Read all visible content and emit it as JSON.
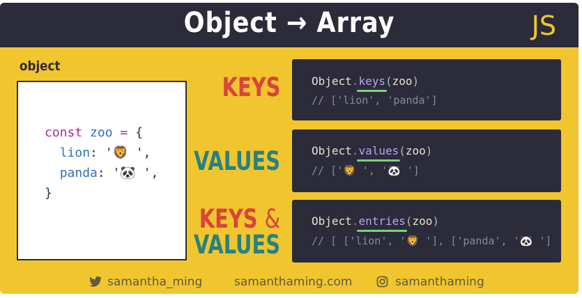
{
  "header": {
    "title": "Object → Array",
    "badge": "JS"
  },
  "object_panel": {
    "label": "object",
    "code": {
      "kw": "const",
      "name": "zoo",
      "op": "=",
      "open": "{",
      "key1": "lion",
      "val1": "'🦁 ',",
      "key2": "panda",
      "val2": "'🐼 ',",
      "close": "}"
    }
  },
  "sections": [
    {
      "label": "KEYS",
      "object": "Object",
      "method": "keys",
      "arg": "zoo",
      "result": "// ['lion', 'panda']"
    },
    {
      "label": "VALUES",
      "object": "Object",
      "method": "values",
      "arg": "zoo",
      "result": "// ['🦁 ', '🐼 ']"
    },
    {
      "label_a": "KEYS",
      "label_amp": "&",
      "label_b": "VALUES",
      "object": "Object",
      "method": "entries",
      "arg": "zoo",
      "result": "// [ ['lion', '🦁 '], ['panda', '🐼 ']"
    }
  ],
  "footer": {
    "twitter": "samantha_ming",
    "website": "samanthaming.com",
    "instagram": "samanthaming"
  },
  "colors": {
    "yellow": "#f1c52e",
    "dark": "#2c2b3a",
    "red": "#d9443c",
    "teal": "#27827f",
    "method": "#b9a6f0",
    "underline": "#7bd37a"
  }
}
